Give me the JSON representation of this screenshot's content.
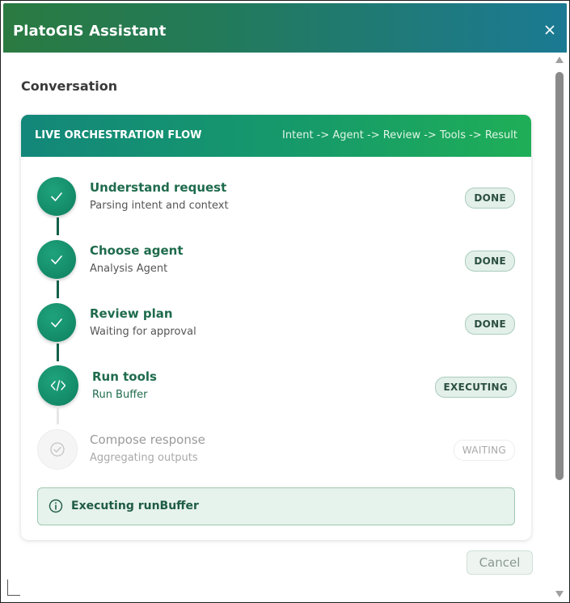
{
  "window": {
    "title": "PlatoGIS Assistant",
    "close_label": "×"
  },
  "conversation": {
    "heading": "Conversation"
  },
  "flow": {
    "title": "LIVE ORCHESTRATION FLOW",
    "path": "Intent -> Agent -> Review -> Tools -> Result",
    "steps": [
      {
        "title": "Understand request",
        "subtitle": "Parsing intent and context",
        "status": "DONE",
        "state": "done",
        "icon": "check-icon"
      },
      {
        "title": "Choose agent",
        "subtitle": "Analysis Agent",
        "status": "DONE",
        "state": "done",
        "icon": "check-icon"
      },
      {
        "title": "Review plan",
        "subtitle": "Waiting for approval",
        "status": "DONE",
        "state": "done",
        "icon": "check-icon"
      },
      {
        "title": "Run tools",
        "subtitle": "Run Buffer",
        "status": "EXECUTING",
        "state": "executing",
        "icon": "code-icon"
      },
      {
        "title": "Compose response",
        "subtitle": "Aggregating outputs",
        "status": "WAITING",
        "state": "waiting",
        "icon": "check-circle-icon"
      }
    ],
    "info_message": "Executing runBuffer",
    "info_icon": "info-icon"
  },
  "actions": {
    "cancel_label": "Cancel"
  },
  "colors": {
    "accent_green": "#138a68",
    "header_start": "#2a7a41",
    "header_end": "#1b7a93"
  }
}
